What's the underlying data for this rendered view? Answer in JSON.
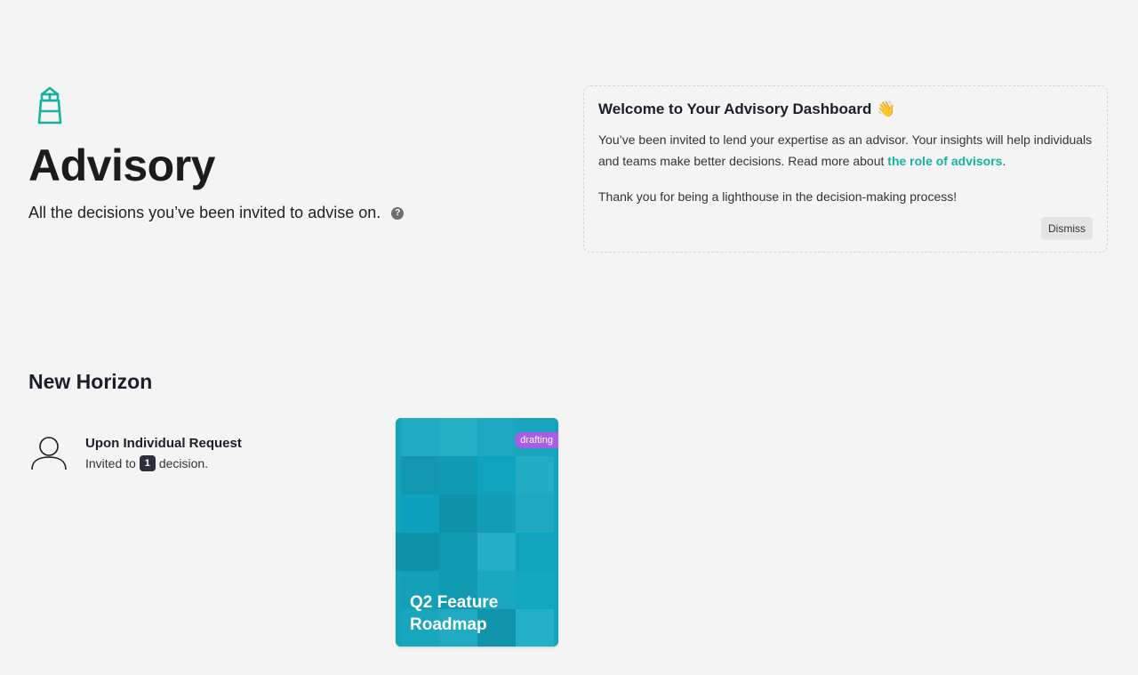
{
  "header": {
    "title": "Advisory",
    "subtitle": "All the decisions you’ve been invited to advise on.",
    "help": "?"
  },
  "welcome": {
    "title": "Welcome to Your Advisory Dashboard",
    "wave": "👋",
    "body_prefix": "You’ve been invited to lend your expertise as an advisor. Your insights will help individuals and teams make better decisions. Read more about ",
    "link_text": "the role of advisors",
    "body_suffix": ".",
    "thanks": "Thank you for being a lighthouse in the decision-making process!",
    "dismiss_label": "Dismiss"
  },
  "section": {
    "title": "New Horizon",
    "advisor": {
      "name": "Upon Individual Request",
      "invited_prefix": "Invited to",
      "count": "1",
      "invited_suffix": "decision."
    },
    "decision": {
      "title": "Q2 Feature Roadmap",
      "status": "drafting"
    }
  },
  "colors": {
    "accent": "#14b3a0",
    "card": "#14a3b8",
    "status": "#a85de6"
  }
}
